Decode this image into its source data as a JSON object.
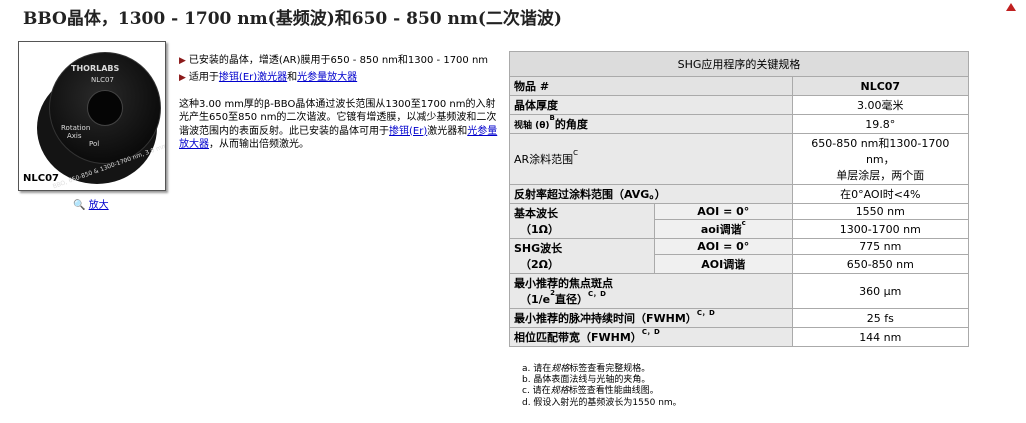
{
  "page_title": "BBO晶体，1300 - 1700 nm(基频波)和650 - 850 nm(二次谐波)",
  "photo": {
    "caption": "NLC07",
    "brand": "THORLABS",
    "model": "NLC07",
    "rotation": "Rotation",
    "axis": "Axis",
    "pol": "Pol",
    "side": "BBO, 650-850 & 1300-1700 nm, 3.0 mm thick"
  },
  "zoom": {
    "icon": "magnifier-icon",
    "label": "放大"
  },
  "bullets": [
    {
      "text": "已安装的晶体，增透(AR)膜用于650 - 850 nm和1300 - 1700 nm"
    },
    {
      "pre": "适用于",
      "link1": "掺铒(Er)激光器",
      "mid": "和",
      "link2": "光参量放大器"
    }
  ],
  "description": {
    "part1": "这种3.00 mm厚的β-BBO晶体通过波长范围从1300至1700 nm的入射光产生650至850 nm的二次谐波。它镀有增透膜，以减少基频波和二次谐波范围内的表面反射。此已安装的晶体可用于",
    "link1": "掺铒(Er)",
    "part2": "激光器和",
    "link2": "光参量放大器",
    "part3": "，从而输出倍频激光。"
  },
  "spec_table": {
    "title": "SHG应用程序的关键规格",
    "header": {
      "label": "物品 #",
      "value": "NLC07"
    },
    "rows": {
      "thickness": {
        "label": "晶体厚度",
        "value": "3.00毫米"
      },
      "angle": {
        "label_pre": "视轴 (θ)",
        "sup": "B",
        "label_post": "的角度",
        "value": "19.8°"
      },
      "ar": {
        "label": "AR涂料范围",
        "sup": "C",
        "value_line1": "650-850 nm和1300-1700 nm，",
        "value_line2": "单层涂层，两个面"
      },
      "reflect": {
        "label": "反射率超过涂料范围（AVG。）",
        "value": "在0°AOI时<4%"
      },
      "fund": {
        "label_line1": "基本波长",
        "label_line2": "（1Ω）",
        "sub1": "AOI = 0°",
        "val1": "1550 nm",
        "sub2": "aoi调谐",
        "sub2_sup": "c",
        "val2": "1300-1700 nm"
      },
      "shg": {
        "label_line1": "SHG波长",
        "label_line2": "（2Ω）",
        "sub1": "AOI = 0°",
        "val1": "775 nm",
        "sub2": "AOI调谐",
        "val2": "650-850 nm"
      },
      "spot": {
        "label_line1": "最小推荐的焦点斑点",
        "label_line2_pre": "（1/e",
        "label_line2_sup": "2",
        "label_line2_post": "直径）",
        "sup": "C，D",
        "value": "360 μm"
      },
      "pulse": {
        "label": "最小推荐的脉冲持续时间（FWHM）",
        "sup": "C，D",
        "value": "25 fs"
      },
      "bandwidth": {
        "label": "相位匹配带宽（FWHM）",
        "sup": "C，D",
        "value": "144 nm"
      }
    }
  },
  "notes": [
    {
      "pre": "a. 请在",
      "em": "规格",
      "post": "标签查看完整规格。"
    },
    {
      "pre": "b. 晶体表面法线与光轴的夹角。",
      "em": "",
      "post": ""
    },
    {
      "pre": "c. 请在",
      "em": "规格",
      "post": "标签查看性能曲线图。"
    },
    {
      "pre": "d. 假设入射光的基频波长为1550 nm。",
      "em": "",
      "post": ""
    }
  ],
  "colors": {
    "bullet_triangle": "#8b1a1a",
    "link": "#0000cc",
    "top_arrow": "#c02020"
  }
}
